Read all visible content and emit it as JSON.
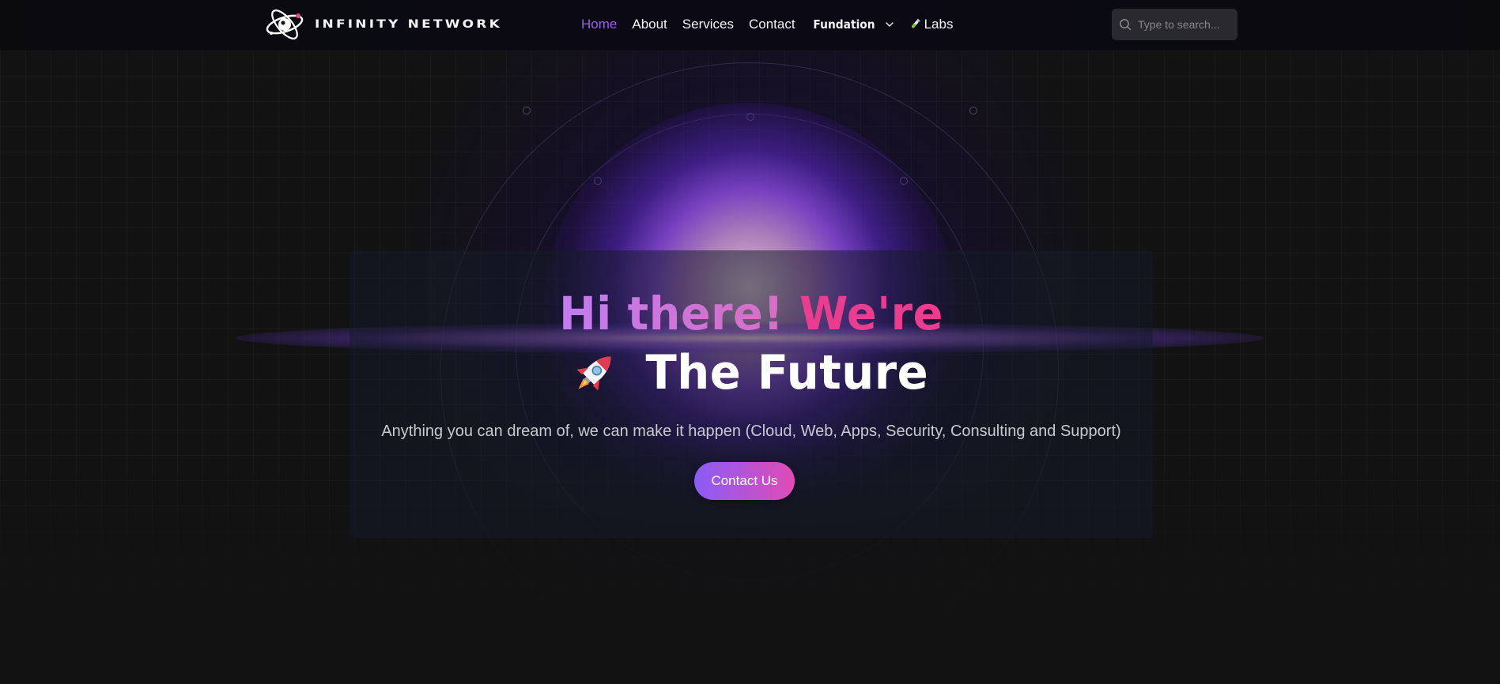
{
  "brand": {
    "name": "Infinity Network",
    "logo_icon": "planet-orbit-logo-icon"
  },
  "nav": {
    "items": [
      {
        "label": "Home",
        "active": true
      },
      {
        "label": "About",
        "active": false
      },
      {
        "label": "Services",
        "active": false
      },
      {
        "label": "Contact",
        "active": false
      }
    ],
    "dropdown": {
      "label": "Fundation",
      "icon": "chevron-down-icon"
    },
    "labs": {
      "label": "Labs",
      "icon": "flask-icon"
    },
    "active_color": "#9b5cf0"
  },
  "search": {
    "placeholder": "Type to search...",
    "value": "",
    "icon": "search-icon"
  },
  "hero": {
    "title_part1": "Hi there!",
    "title_part2": "We're",
    "title_line2": "The Future",
    "title_icon": "rocket-icon",
    "subtitle": "Anything you can dream of, we can make it happen (Cloud, Web, Apps, Security, Consulting and Support)",
    "cta_label": "Contact Us",
    "colors": {
      "purple": "#c085f2",
      "pink": "#ea3d8f",
      "cta_start": "#8a5cf6",
      "cta_end": "#e04bb5"
    }
  }
}
